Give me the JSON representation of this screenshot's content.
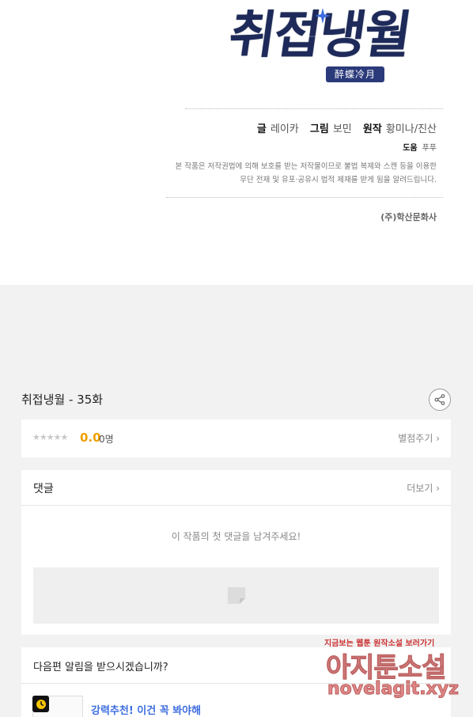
{
  "credits": {
    "logo_title": "취접냉월",
    "logo_subtitle": "醉蝶冷月",
    "writer_label": "글",
    "writer": "레이카",
    "artist_label": "그림",
    "artist": "보민",
    "original_label": "원작",
    "original": "황미나/진산",
    "assist_label": "도움",
    "assist": "푸푸",
    "notice_line1": "본 작품은 저작권법에 의해 보호를 받는 저작물이므로 불법 복제와 스캔 등을 이용한",
    "notice_line2": "무단 전재 및 유포·공유시 법적 제재를 받게 됨을 알려드립니다.",
    "publisher": "(주)학산문화사"
  },
  "episode": {
    "title": "취접냉월 - 35화",
    "share_icon": "share-icon"
  },
  "rating": {
    "stars": "★★★★★",
    "score": "0.0",
    "count": "0명",
    "rate_label": "별점주기 ›"
  },
  "comments": {
    "title": "댓글",
    "more_label": "더보기 ›",
    "empty_message": "이 작품의 첫 댓글을 남겨주세요!",
    "input_icon": "comment-placeholder-icon"
  },
  "notify": {
    "question": "다음편 알림을 받으시겠습니까?",
    "recommend_title": "강력추천! 이건 꼭 봐야해",
    "badge_icon": "clock-icon"
  },
  "watermark": {
    "tagline_a": "지금보는 웹툰 ",
    "tagline_b": "원작소설",
    "tagline_c": " 보러가기",
    "brand": "아지툰소설",
    "url": "novelagit.xyz"
  },
  "colors": {
    "score": "#f0a000",
    "link": "#3d6de0",
    "background": "#f2f2f2"
  }
}
